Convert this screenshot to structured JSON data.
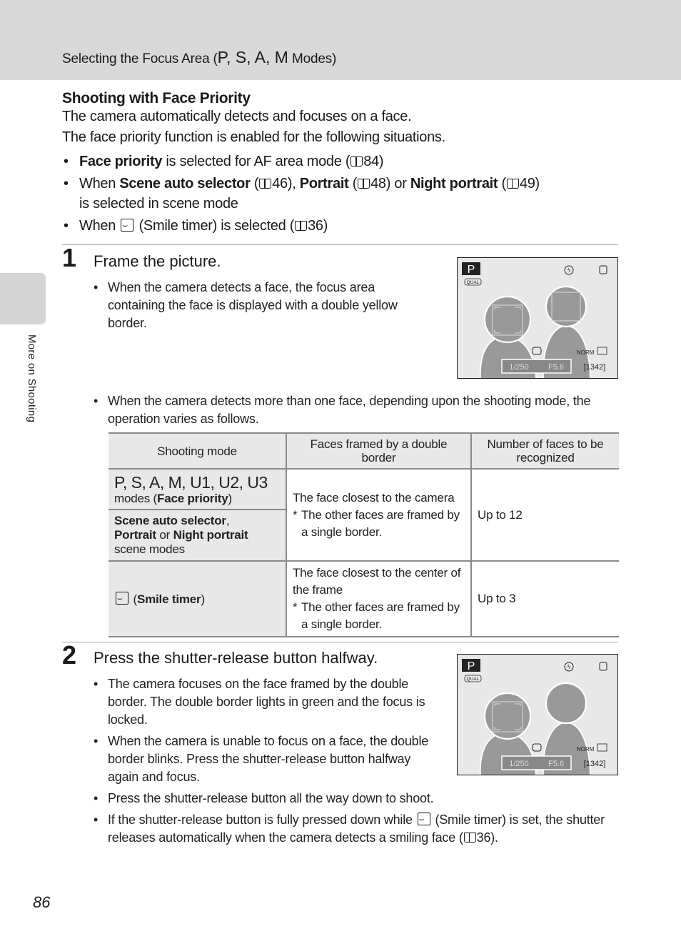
{
  "header": {
    "title_prefix": "Selecting the Focus Area (",
    "title_modes": "P, S, A, M",
    "title_suffix": " Modes)"
  },
  "side_tab": {
    "label": "More on Shooting"
  },
  "section": {
    "title": "Shooting with Face Priority",
    "intro_lines": [
      "The camera automatically detects and focuses on a face.",
      "The face priority function is enabled for the following situations."
    ],
    "bullets": [
      {
        "bold": "Face priority",
        "text": " is selected for AF area mode (",
        "ref": "84",
        "end": ")"
      },
      {
        "pre": "When ",
        "bold1": "Scene auto selector",
        "t1": " (",
        "ref1": "46",
        "t2": "), ",
        "bold2": "Portrait",
        "t3": " (",
        "ref2": "48",
        "t4": ") or ",
        "bold3": "Night portrait",
        "t5": " (",
        "ref3": "49",
        "t6": ")",
        "line2": "is selected in scene mode"
      },
      {
        "pre": "When ",
        "icon": "smile-timer-icon",
        "text": " (Smile timer) is selected (",
        "ref": "36",
        "end": ")"
      }
    ]
  },
  "step1": {
    "number": "1",
    "title": "Frame the picture.",
    "bullet1": "When the camera detects a face, the focus area containing the face is displayed with a double yellow border.",
    "bullet2": "When the camera detects more than one face, depending upon the shooting mode, the operation varies as follows."
  },
  "screen": {
    "mode": "P",
    "qual": "QUAL",
    "norm": "NORM",
    "shutter": "1/250",
    "aperture": "F5.6",
    "remaining": "[1342]"
  },
  "table": {
    "headers": [
      "Shooting mode",
      "Faces framed by a double border",
      "Number of faces to be recognized"
    ],
    "rows": [
      {
        "mode_big": "P, S, A, M, U1, U2, U3",
        "mode_pre": "modes (",
        "mode_bold": "Face priority",
        "mode_post": ")"
      },
      {
        "mode_b1": "Scene auto selector",
        "mode_t1": ",",
        "mode_b2": "Portrait",
        "mode_t2": " or ",
        "mode_b3": "Night portrait",
        "mode_t3": "scene modes",
        "faces": "The face closest to the camera",
        "faces_note": "The other faces are framed by a single border.",
        "count": "Up to 12"
      },
      {
        "mode_bold": "Smile timer",
        "faces": "The face closest to the center of the frame",
        "faces_note": "The other faces are framed by a single border.",
        "count": "Up to 3"
      }
    ],
    "note_marker": "*"
  },
  "step2": {
    "number": "2",
    "title": "Press the shutter-release button halfway.",
    "bullets": [
      "The camera focuses on the face framed by the double border. The double border lights in green and the focus is locked.",
      "When the camera is unable to focus on a face, the double border blinks. Press the shutter-release button halfway again and focus.",
      "Press the shutter-release button all the way down to shoot."
    ],
    "bullet4_pre": "If the shutter-release button is fully pressed down while ",
    "bullet4_mid": " (Smile timer) is set, the shutter releases automatically when the camera detects a smiling face (",
    "bullet4_ref": "36",
    "bullet4_end": ")."
  },
  "footer": {
    "page_number": "86"
  },
  "bullet_char": "•"
}
